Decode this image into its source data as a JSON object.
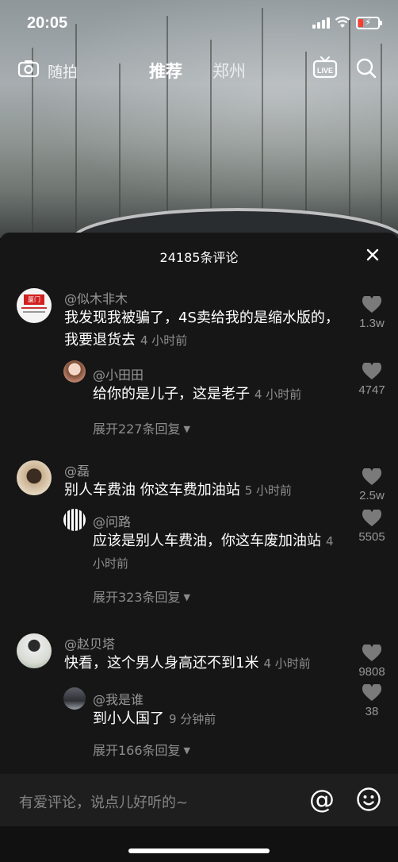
{
  "status_bar": {
    "time": "20:05"
  },
  "top_nav": {
    "random_label": "随拍",
    "recommend_label": "推荐",
    "city_label": "郑州",
    "live_label": "LIVE"
  },
  "comments_panel": {
    "count_label": "24185条评论",
    "comments": [
      {
        "user": "@似木非木",
        "text": "我发现我被骗了，4S卖给我的是缩水版的，我要退货去",
        "time": "4 小时前",
        "likes": "1.3w",
        "avatar_text": "厦门",
        "reply": {
          "user": "@小田田",
          "text": "给你的是儿子，这是老子",
          "time": "4 小时前",
          "likes": "4747"
        },
        "expand_label": "展开227条回复"
      },
      {
        "user": "@磊",
        "text": "别人车费油 你这车费加油站",
        "time": "5 小时前",
        "likes": "2.5w",
        "reply": {
          "user": "@问路",
          "text": "应该是别人车费油，你这车废加油站",
          "time": "4 小时前",
          "likes": "5505"
        },
        "expand_label": "展开323条回复"
      },
      {
        "user": "@赵贝塔",
        "text": "快看，这个男人身高还不到1米",
        "time": "4 小时前",
        "likes": "9808",
        "reply": {
          "user": "@我是谁",
          "text": "到小人国了",
          "time": "9 分钟前",
          "likes": "38"
        },
        "expand_label": "展开166条回复"
      }
    ]
  },
  "input_bar": {
    "placeholder": "有爱评论，说点儿好听的~",
    "at_symbol": "@"
  },
  "colors": {
    "panel_bg": "#161616",
    "secondary_text": "#8a8a8a",
    "battery_low": "#ff3b30"
  }
}
